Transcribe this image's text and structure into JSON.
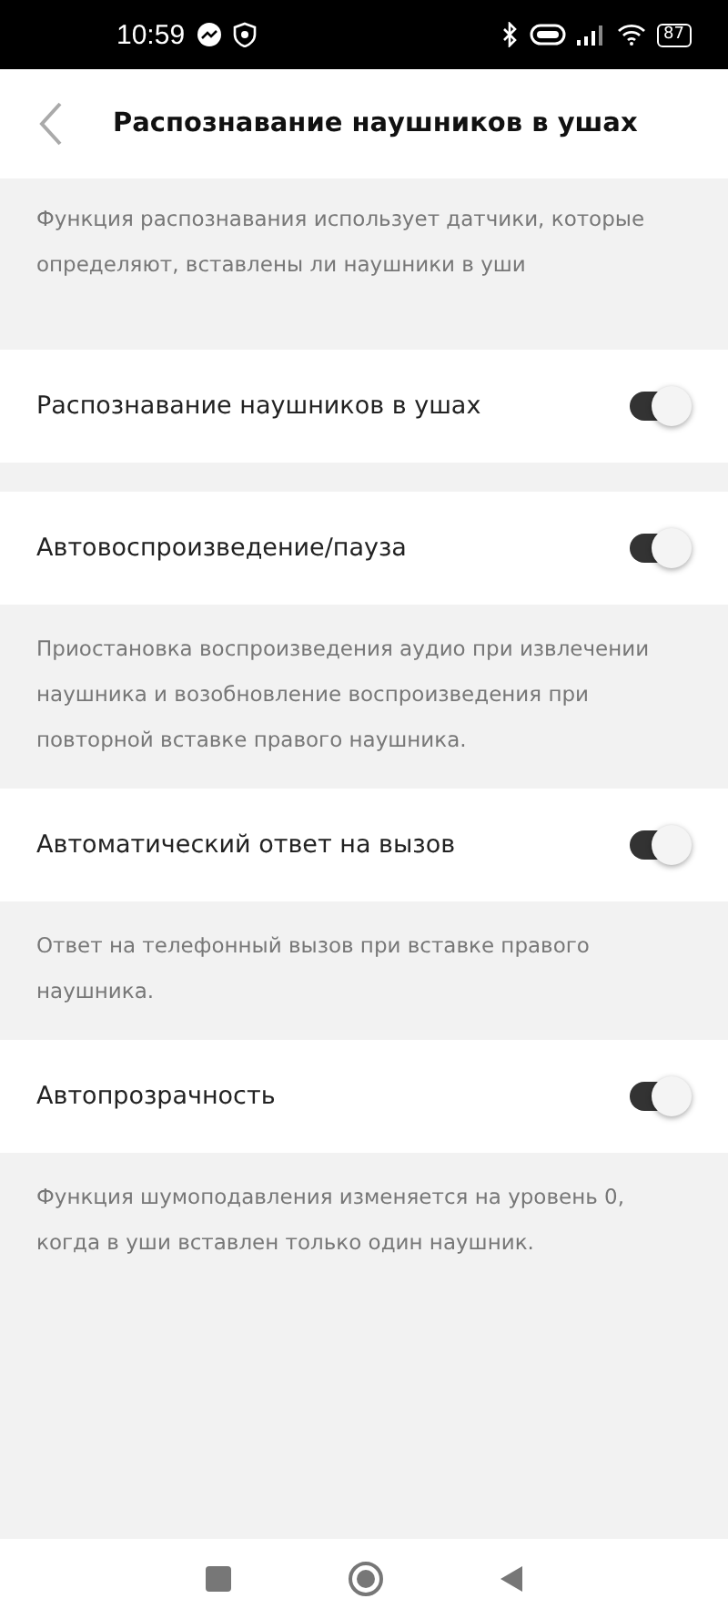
{
  "status_bar": {
    "time": "10:59",
    "battery": "87"
  },
  "header": {
    "title": "Распознавание наушников в ушах"
  },
  "intro": "Функция распознавания использует датчики, которые определяют, вставлены ли наушники в уши",
  "settings": [
    {
      "label": "Распознавание наушников в ушах",
      "on": true
    },
    {
      "label": "Автовоспроизведение/пауза",
      "on": true,
      "description": "Приостановка воспроизведения аудио при извлечении наушника и возобновление воспроизведения при повторной вставке правого наушника."
    },
    {
      "label": "Автоматический ответ на вызов",
      "on": true,
      "description": "Ответ на телефонный вызов при вставке правого наушника."
    },
    {
      "label": "Автопрозрачность",
      "on": true,
      "description": "Функция шумоподавления изменяется на уровень 0, когда в уши вставлен только один наушник."
    }
  ]
}
